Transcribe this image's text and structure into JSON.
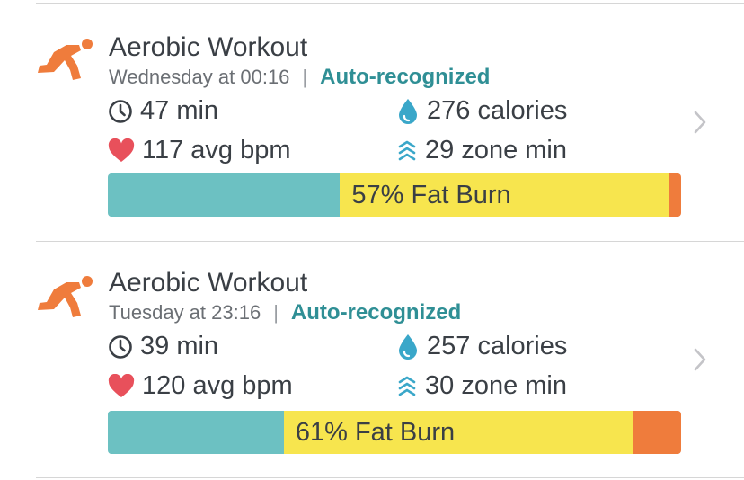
{
  "workouts": [
    {
      "title": "Aerobic Workout",
      "when": "Wednesday at 00:16",
      "separator": "|",
      "recognition": "Auto-recognized",
      "duration": "47 min",
      "calories": "276 calories",
      "heart_rate": "117 avg bpm",
      "zone": "29 zone min",
      "bar": {
        "label": "57% Fat Burn",
        "segments": [
          0.405,
          0.573,
          0.022
        ]
      },
      "icons": [
        "runner-icon",
        "clock-icon",
        "flame-drop-icon",
        "heart-icon",
        "zone-chevrons-icon",
        "chevron-right-icon"
      ]
    },
    {
      "title": "Aerobic Workout",
      "when": "Tuesday at 23:16",
      "separator": "|",
      "recognition": "Auto-recognized",
      "duration": "39 min",
      "calories": "257 calories",
      "heart_rate": "120 avg bpm",
      "zone": "30 zone min",
      "bar": {
        "label": "61% Fat Burn",
        "segments": [
          0.307,
          0.61,
          0.083
        ]
      },
      "icons": [
        "runner-icon",
        "clock-icon",
        "flame-drop-icon",
        "heart-icon",
        "zone-chevrons-icon",
        "chevron-right-icon"
      ]
    }
  ],
  "colors": {
    "accent_teal": "#2f8f95",
    "peak_segment": "#6cc1c2",
    "fat_burn_segment": "#f7e54e",
    "cardio_segment": "#ef7c3c",
    "runner_orange": "#ef7c3c",
    "heart_red": "#e8505b",
    "drop_blue": "#3aa7c9"
  }
}
